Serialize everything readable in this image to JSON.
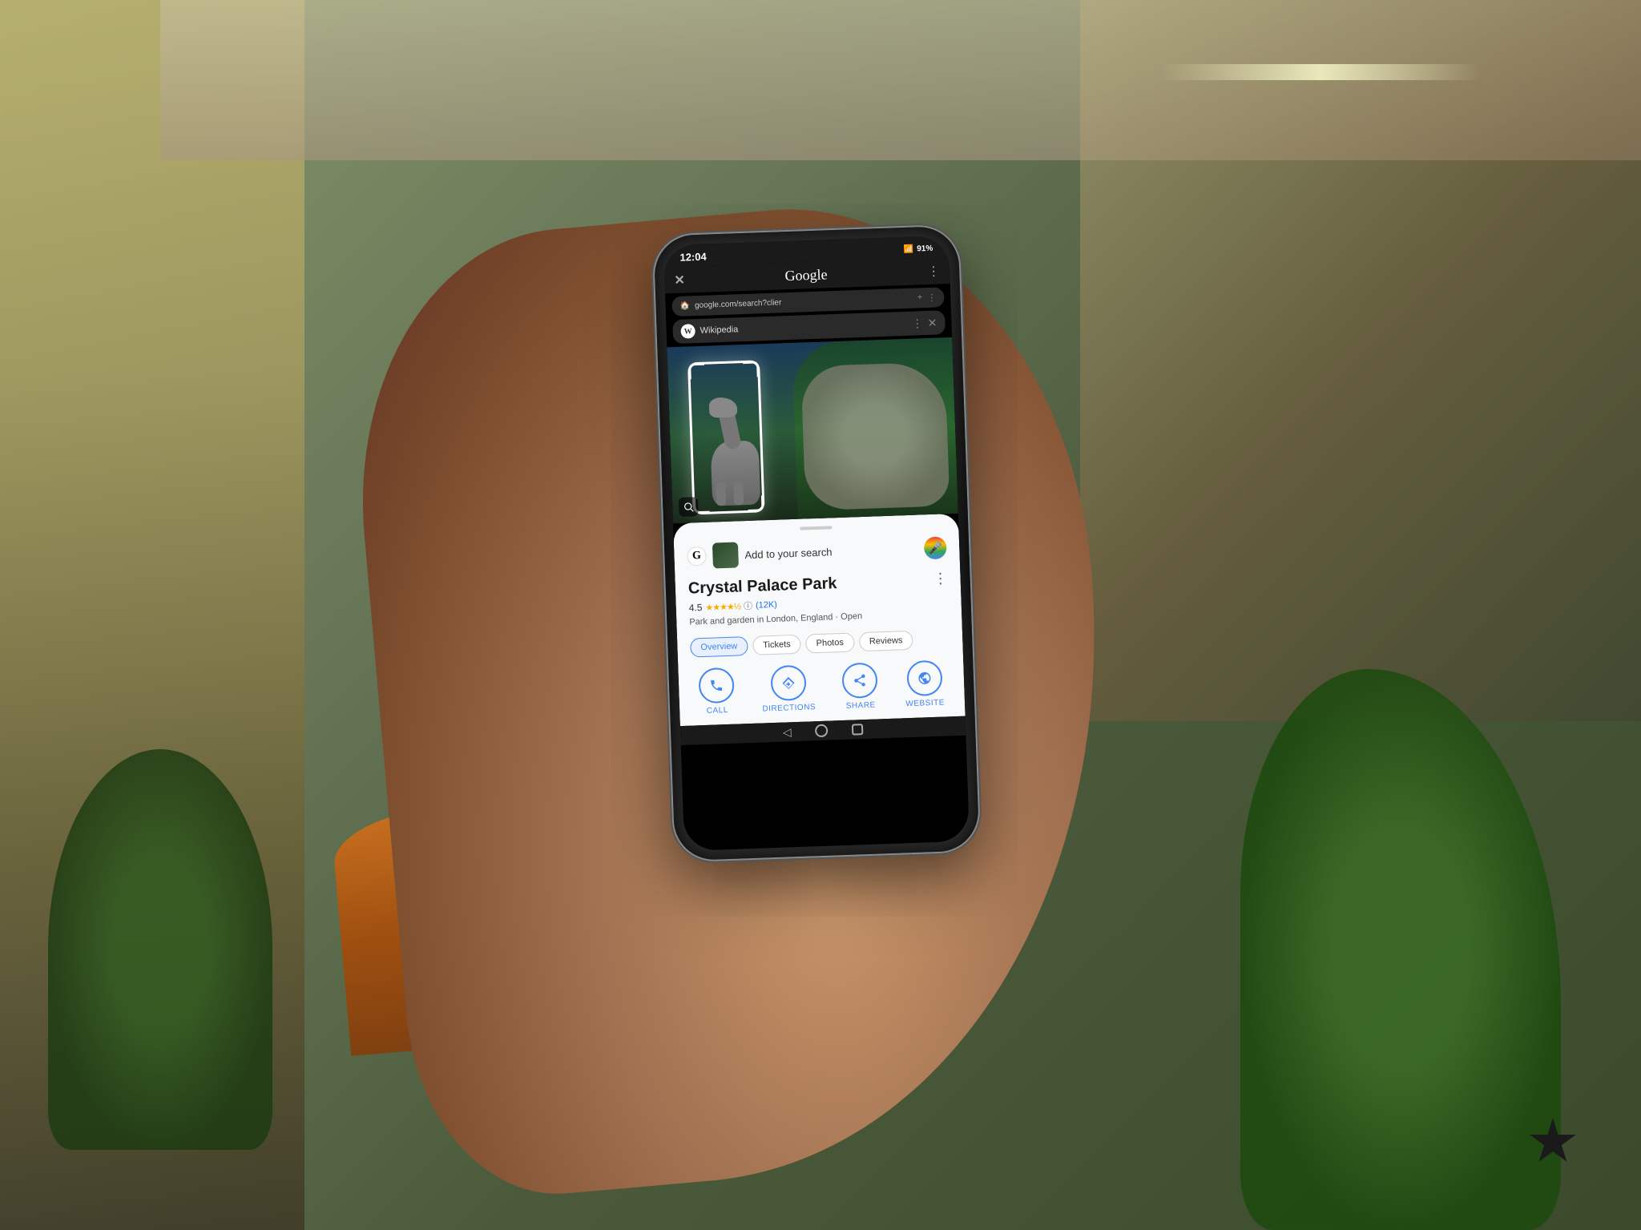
{
  "background": {
    "description": "Office/lobby background with plants and wooden walls"
  },
  "phone": {
    "status_bar": {
      "time": "12:04",
      "signal": "📶",
      "wifi": "WiFi",
      "battery": "91%"
    },
    "chrome": {
      "close_label": "✕",
      "title": "Google",
      "menu_label": "⋮",
      "url": "google.com/search?clier",
      "add_tab_label": "+",
      "tab_menu_label": "⋮"
    },
    "wikipedia_pill": {
      "icon_text": "W",
      "label": "Wikipedia",
      "dots_label": "⋮",
      "close_label": "✕"
    },
    "lens_icon": "⊙",
    "bottom_sheet": {
      "search_placeholder": "Add to your search",
      "mic_label": "🎤",
      "place": {
        "name": "Crystal Palace Park",
        "rating": "4.5",
        "stars": "★★★★½",
        "rating_info": "ⓘ",
        "review_count": "(12K)",
        "description": "Park and garden in London, England · Open",
        "more_label": "⋮"
      },
      "tabs": [
        {
          "label": "Overview",
          "active": true
        },
        {
          "label": "Tickets",
          "active": false
        },
        {
          "label": "Photos",
          "active": false
        },
        {
          "label": "Reviews",
          "active": false
        }
      ],
      "actions": [
        {
          "icon": "📞",
          "label": "CALL"
        },
        {
          "icon": "◆",
          "label": "DIRECTIONS"
        },
        {
          "icon": "↗",
          "label": "SHARE"
        },
        {
          "icon": "🌐",
          "label": "WEBSITE"
        }
      ]
    },
    "nav_bar": {
      "back_label": "◁",
      "home_label": "○",
      "recents_label": "□"
    }
  }
}
